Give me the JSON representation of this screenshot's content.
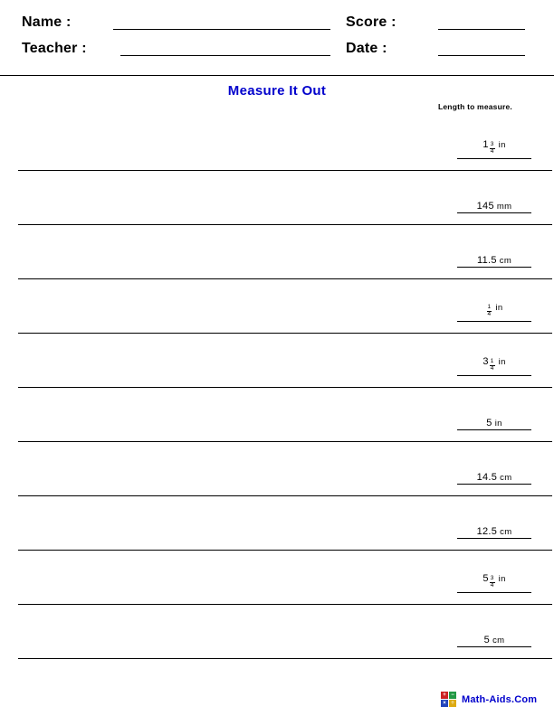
{
  "header": {
    "name_label": "Name :",
    "teacher_label": "Teacher :",
    "score_label": "Score :",
    "date_label": "Date :",
    "name_value": "",
    "teacher_value": "",
    "score_value": "",
    "date_value": ""
  },
  "title": "Measure It Out",
  "title_color": "#0000cc",
  "column_caption": "Length to measure.",
  "rows": [
    {
      "whole": "1",
      "numerator": "3",
      "denominator": "4",
      "decimal": "",
      "unit": "in"
    },
    {
      "whole": "",
      "numerator": "",
      "denominator": "",
      "decimal": "145",
      "unit": "mm"
    },
    {
      "whole": "",
      "numerator": "",
      "denominator": "",
      "decimal": "11.5",
      "unit": "cm"
    },
    {
      "whole": "",
      "numerator": "1",
      "denominator": "4",
      "decimal": "",
      "unit": "in"
    },
    {
      "whole": "3",
      "numerator": "1",
      "denominator": "4",
      "decimal": "",
      "unit": "in"
    },
    {
      "whole": "",
      "numerator": "",
      "denominator": "",
      "decimal": "5",
      "unit": "in"
    },
    {
      "whole": "",
      "numerator": "",
      "denominator": "",
      "decimal": "14.5",
      "unit": "cm"
    },
    {
      "whole": "",
      "numerator": "",
      "denominator": "",
      "decimal": "12.5",
      "unit": "cm"
    },
    {
      "whole": "5",
      "numerator": "3",
      "denominator": "4",
      "decimal": "",
      "unit": "in"
    },
    {
      "whole": "",
      "numerator": "",
      "denominator": "",
      "decimal": "5",
      "unit": "cm"
    }
  ],
  "footer": {
    "brand": "Math-Aids.Com",
    "brand_color": "#0000cc",
    "logo_cells": [
      {
        "symbol": "+",
        "color": "#cc2222"
      },
      {
        "symbol": "−",
        "color": "#229944"
      },
      {
        "symbol": "×",
        "color": "#2244bb"
      },
      {
        "symbol": "÷",
        "color": "#ddaa11"
      }
    ]
  }
}
